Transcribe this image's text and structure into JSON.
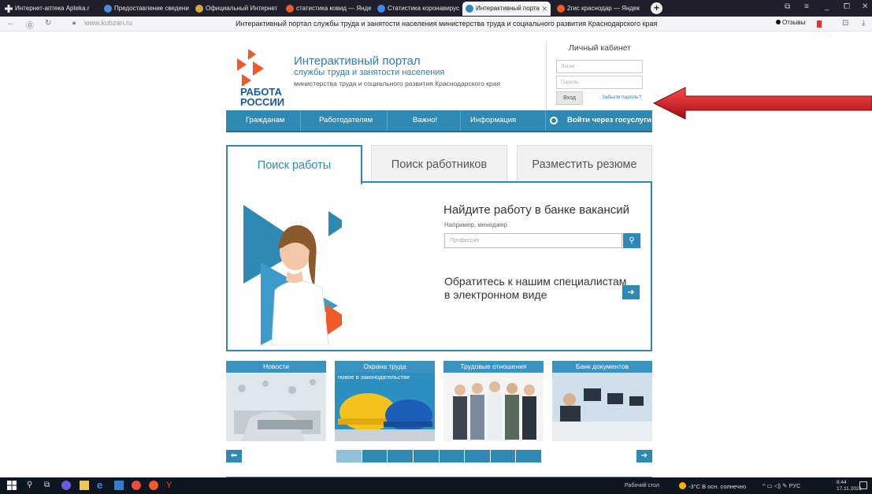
{
  "browser": {
    "tabs": [
      {
        "label": "Интернет-аптека Apteka.r",
        "color": "#e8e8e8"
      },
      {
        "label": "Предоставление сведени",
        "color": "#4a90d9"
      },
      {
        "label": "Официальный Интернет",
        "color": "#d7a43b"
      },
      {
        "label": "статистика ковид — Янде",
        "color": "#f05a28"
      },
      {
        "label": "Статистика коронавирус",
        "color": "#4285f4"
      },
      {
        "label": "Интерактивный порта",
        "color": "#2e8ab5"
      },
      {
        "label": "2гис краснодар — Яндек",
        "color": "#f05a28"
      }
    ],
    "url": "www.kubzan.ru",
    "page_title": "Интерактивный портал службы труда и занятости населения министерства труда и социального развития Краснодарского края",
    "reviews_label": "Отзывы"
  },
  "header": {
    "logo_line1": "РАБОТА",
    "logo_line2": "РОССИИ",
    "title": "Интерактивный портал",
    "subtitle": "службы труда и занятости населения",
    "ministry": "министерства труда и социального развития Краснодарского края"
  },
  "cabinet": {
    "title": "Личный кабинет",
    "login_placeholder": "Логин",
    "password_placeholder": "Пароль",
    "login_button": "Вход",
    "forgot": "Забыли пароль?"
  },
  "menu": {
    "items": [
      "Гражданам",
      "Работодателям",
      "Важно!",
      "Информация"
    ],
    "gosuslugi": "Войти через госуслуги"
  },
  "search_tabs": [
    "Поиск работы",
    "Поиск работников",
    "Разместить резюме"
  ],
  "search": {
    "title": "Найдите работу в банке вакансий",
    "example": "Например, менеджер",
    "placeholder": "Профессия",
    "contact_line1": "Обратитесь к нашим специалистам",
    "contact_line2": "в электронном виде"
  },
  "cards": [
    {
      "title": "Новости",
      "subtitle": ""
    },
    {
      "title": "Охрана труда",
      "subtitle": "новое в законодательстве"
    },
    {
      "title": "Трудовые отношения",
      "subtitle": ""
    },
    {
      "title": "Банк документов",
      "subtitle": ""
    }
  ],
  "pager": {
    "segments": 8,
    "active": 1
  },
  "taskbar": {
    "desktop_label": "Рабочий стол",
    "weather": "-3°C  В осн. солнечно",
    "lang": "РУС",
    "time": "8:44",
    "date": "17.11.2021"
  },
  "colors": {
    "accent": "#2e8ab5",
    "logo_orange": "#f05a28",
    "logo_blue": "#1a5a9a",
    "annotation_arrow": "#c8161d"
  }
}
